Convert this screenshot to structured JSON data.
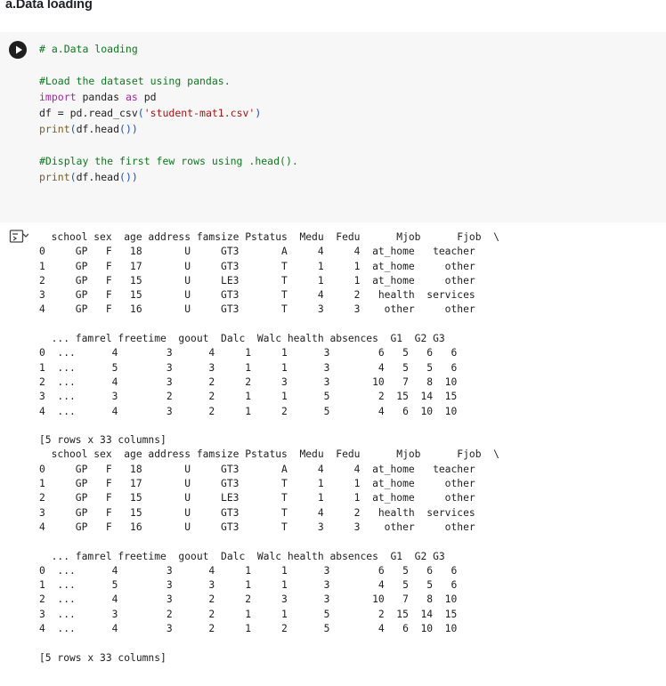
{
  "section_heading": "a.Data loading",
  "cell": {
    "run_button_label": "Run cell",
    "code_lines": [
      [
        {
          "t": "# a.Data loading",
          "c": "cm"
        }
      ],
      [],
      [
        {
          "t": "#Load the dataset using pandas.",
          "c": "cm"
        }
      ],
      [
        {
          "t": "import",
          "c": "kw"
        },
        {
          "t": " pandas ",
          "c": "pl"
        },
        {
          "t": "as",
          "c": "kw"
        },
        {
          "t": " pd",
          "c": "pl"
        }
      ],
      [
        {
          "t": "df = pd.",
          "c": "pl"
        },
        {
          "t": "read_csv",
          "c": "pl"
        },
        {
          "t": "(",
          "c": "br"
        },
        {
          "t": "'student-mat1.csv'",
          "c": "str"
        },
        {
          "t": ")",
          "c": "br"
        }
      ],
      [
        {
          "t": "print",
          "c": "fn"
        },
        {
          "t": "(",
          "c": "br"
        },
        {
          "t": "df.head",
          "c": "pl"
        },
        {
          "t": "())",
          "c": "br"
        }
      ],
      [],
      [
        {
          "t": "#Display the first few rows using .head().",
          "c": "cm"
        }
      ],
      [
        {
          "t": "print",
          "c": "fn"
        },
        {
          "t": "(",
          "c": "br"
        },
        {
          "t": "df.head",
          "c": "pl"
        },
        {
          "t": "())",
          "c": "br"
        }
      ]
    ]
  },
  "output": {
    "toggle_icon": "output-toggle-icon",
    "lines": [
      "  school sex  age address famsize Pstatus  Medu  Fedu      Mjob      Fjob  \\",
      "0     GP   F   18       U     GT3       A     4     4  at_home   teacher   ",
      "1     GP   F   17       U     GT3       T     1     1  at_home     other   ",
      "2     GP   F   15       U     LE3       T     1     1  at_home     other   ",
      "3     GP   F   15       U     GT3       T     4     2   health  services   ",
      "4     GP   F   16       U     GT3       T     3     3    other     other   ",
      "",
      "  ... famrel freetime  goout  Dalc  Walc health absences  G1  G2 G3  ",
      "0  ...      4        3      4     1     1      3        6   5   6   6  ",
      "1  ...      5        3      3     1     1      3        4   5   5   6  ",
      "2  ...      4        3      2     2     3      3       10   7   8  10  ",
      "3  ...      3        2      2     1     1      5        2  15  14  15  ",
      "4  ...      4        3      2     1     2      5        4   6  10  10  ",
      "",
      "[5 rows x 33 columns]",
      "  school sex  age address famsize Pstatus  Medu  Fedu      Mjob      Fjob  \\",
      "0     GP   F   18       U     GT3       A     4     4  at_home   teacher   ",
      "1     GP   F   17       U     GT3       T     1     1  at_home     other   ",
      "2     GP   F   15       U     LE3       T     1     1  at_home     other   ",
      "3     GP   F   15       U     GT3       T     4     2   health  services   ",
      "4     GP   F   16       U     GT3       T     3     3    other     other   ",
      "",
      "  ... famrel freetime  goout  Dalc  Walc health absences  G1  G2 G3  ",
      "0  ...      4        3      4     1     1      3        6   5   6   6  ",
      "1  ...      5        3      3     1     1      3        4   5   5   6  ",
      "2  ...      4        3      2     2     3      3       10   7   8  10  ",
      "3  ...      3        2      2     1     1      5        2  15  14  15  ",
      "4  ...      4        3      2     1     2      5        4   6  10  10  ",
      "",
      "[5 rows x 33 columns]"
    ]
  }
}
